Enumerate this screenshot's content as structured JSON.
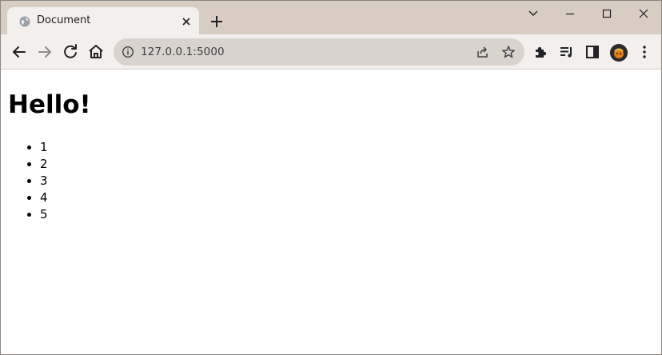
{
  "browser": {
    "tab": {
      "title": "Document"
    },
    "address_bar": {
      "url": "127.0.0.1:5000"
    }
  },
  "page": {
    "heading": "Hello!",
    "list_items": [
      "1",
      "2",
      "3",
      "4",
      "5"
    ]
  },
  "colors": {
    "tab_strip": "#d8cdc2",
    "toolbar": "#f2efec",
    "omnibox": "#d9d3ce",
    "avatar_accent": "#e07b1a"
  }
}
